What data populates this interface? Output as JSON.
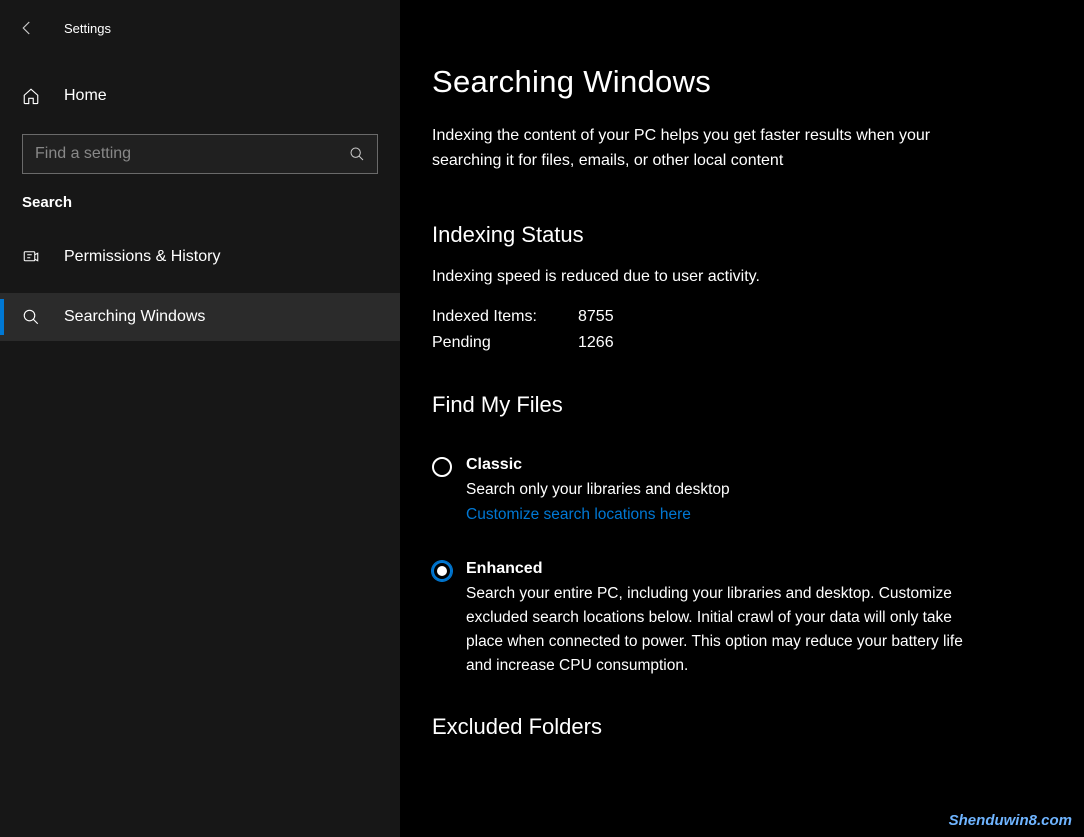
{
  "app": {
    "title": "Settings"
  },
  "sidebar": {
    "home_label": "Home",
    "search_placeholder": "Find a setting",
    "section_label": "Search",
    "items": [
      {
        "label": "Permissions & History"
      },
      {
        "label": "Searching Windows"
      }
    ]
  },
  "main": {
    "title": "Searching Windows",
    "description": "Indexing the content of your PC helps you get faster results when your searching it for files, emails, or other local content",
    "indexing": {
      "heading": "Indexing Status",
      "status_text": "Indexing speed is reduced due to user activity.",
      "indexed_label": "Indexed Items:",
      "indexed_value": "8755",
      "pending_label": "Pending",
      "pending_value": "1266"
    },
    "find_my_files": {
      "heading": "Find My Files",
      "options": [
        {
          "title": "Classic",
          "desc": "Search only your libraries and desktop",
          "link": "Customize search locations here",
          "selected": false
        },
        {
          "title": "Enhanced",
          "desc": "Search your entire PC, including your libraries and desktop. Customize excluded search locations below. Initial crawl of your data will only take place when connected to power. This option may reduce your battery life and increase CPU consumption.",
          "selected": true
        }
      ]
    },
    "excluded": {
      "heading": "Excluded Folders"
    }
  },
  "watermark": "Shenduwin8.com"
}
